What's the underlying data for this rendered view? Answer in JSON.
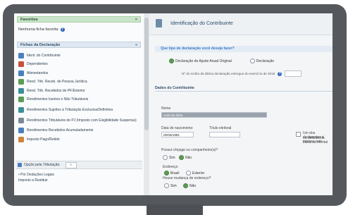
{
  "sidebar": {
    "favorites_header": "Favoritos",
    "favorites_close": "×",
    "no_favorites": "Nenhuma ficha favorita",
    "fichas_header": "Fichas da Declaração",
    "fichas_collapse": "«",
    "items": [
      {
        "label": "Ident. do Contribuinte",
        "icon": "contribuinte-icon",
        "color": "#4b7fbf"
      },
      {
        "label": "Dependentes",
        "icon": "dependentes-icon",
        "color": "#c9503a"
      },
      {
        "label": "Alimentandos",
        "icon": "alimentandos-icon",
        "color": "#4b7fbf"
      },
      {
        "label": "Rend. Trib. Receb. de Pessoa Jurídica",
        "icon": "rendimentos-pj-icon",
        "color": "#5a9d52"
      },
      {
        "label": "Rend. Trib. Recebidos de PF/Exterior",
        "icon": "rendimentos-pf-icon",
        "color": "#3a8f9b"
      },
      {
        "label": "Rendimentos Isentos e Não Tributáveis",
        "icon": "rendimentos-isentos-icon",
        "color": "#5a9d52"
      },
      {
        "label": "Rendimentos Sujeitos à Tributação Exclusiva/Definitiva",
        "icon": "tributacao-exclusiva-icon",
        "color": "#3a8f9b"
      },
      {
        "label": "Rendimentos Tributáveis de PJ (Imposto com Exigibilidade Suspensa)",
        "icon": "exigibilidade-icon",
        "color": "#7d8a96"
      },
      {
        "label": "Rendimentos Recebidos Acumuladamente",
        "icon": "acumulados-icon",
        "color": "#4b7fbf"
      },
      {
        "label": "Imposto Pago/Retido",
        "icon": "imposto-icon",
        "color": "#d1843b"
      }
    ],
    "option_label": "Opção pela Tributação:",
    "search_icon": "magnifier-icon",
    "pending": [
      "Por Deduções Legais",
      "Imposto a Restituir"
    ]
  },
  "main": {
    "title": "Identificação do Contribuinte",
    "question": "Que tipo de declaração você deseja fazer?",
    "radio_options": [
      "Declaração de Ajuste Anual Original",
      "Declaração"
    ],
    "receipt_text": "Nº do recibo da última declaração entregue do exercício de 2018",
    "section_title": "Dados do Contribuinte",
    "nome_label": "Nome",
    "nome_value": "José da Silva",
    "birth_label": "Data de nascimento",
    "birth_value": "00/06/1981",
    "titulo_label": "Título eleitoral",
    "titulo_value": "",
    "declarant_text_1": "Um dos declarantes é pessoa com",
    "declarant_text_2": "ou deficiência física ou mental",
    "spouse_question": "Possui cônjuge ou companheiro(a)?",
    "spouse_options": [
      "Sim",
      "Não"
    ],
    "address_label": "Endereço",
    "address_options": [
      "Brasil",
      "Exterior"
    ],
    "address_change_question": "Houve mudança de endereço?",
    "change_options": [
      "Sim",
      "Não"
    ]
  }
}
